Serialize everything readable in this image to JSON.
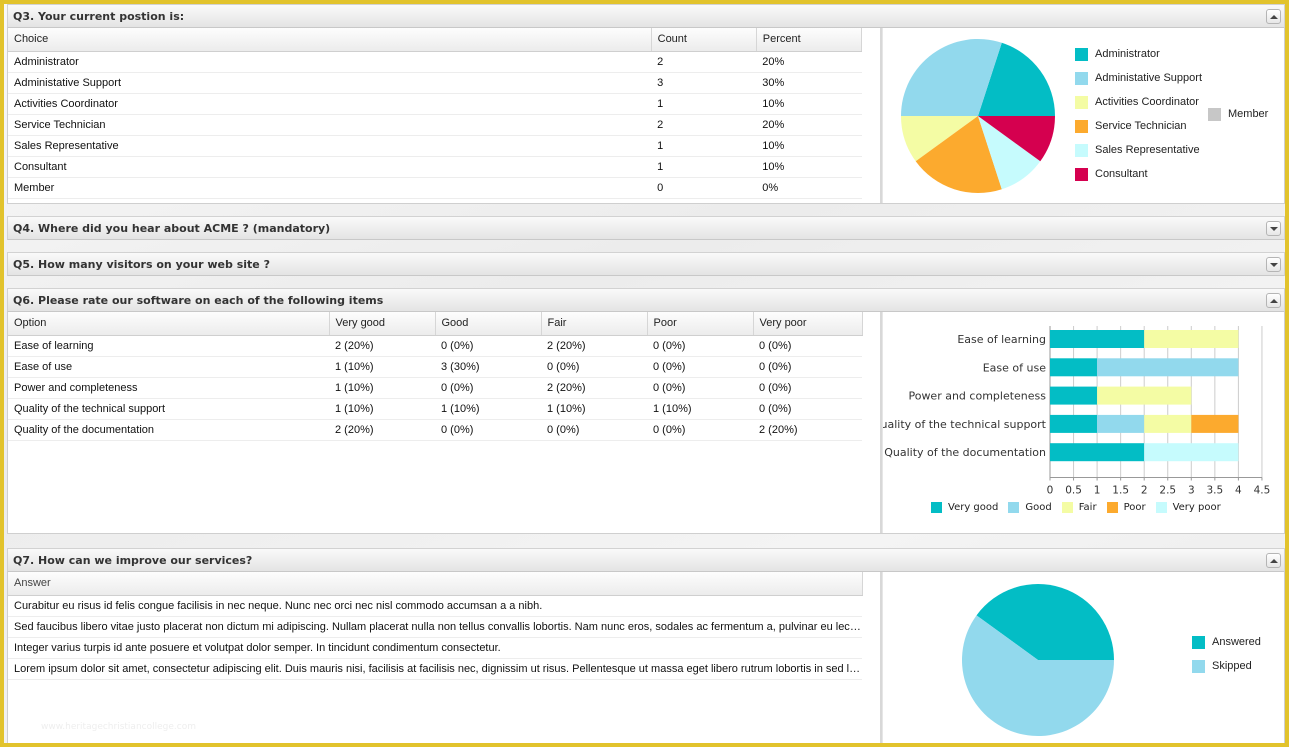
{
  "colors": {
    "teal": "#03bdc5",
    "sky": "#92d9ed",
    "yellow": "#f4fca4",
    "orange": "#fcaa2e",
    "pale_cyan": "#c6fbfd",
    "crimson": "#d5004f",
    "gray": "#c7c7c7"
  },
  "q3": {
    "title": "Q3. Your current postion is:",
    "toggle": "collapse",
    "columns": [
      "Choice",
      "Count",
      "Percent"
    ],
    "rows": [
      {
        "choice": "Administrator",
        "count": "2",
        "percent": "20%"
      },
      {
        "choice": "Administative Support",
        "count": "3",
        "percent": "30%"
      },
      {
        "choice": "Activities Coordinator",
        "count": "1",
        "percent": "10%"
      },
      {
        "choice": "Service Technician",
        "count": "2",
        "percent": "20%"
      },
      {
        "choice": "Sales Representative",
        "count": "1",
        "percent": "10%"
      },
      {
        "choice": "Consultant",
        "count": "1",
        "percent": "10%"
      },
      {
        "choice": "Member",
        "count": "0",
        "percent": "0%"
      }
    ]
  },
  "q4": {
    "title": "Q4. Where did you hear about ACME ? (mandatory)",
    "toggle": "expand"
  },
  "q5": {
    "title": "Q5. How many visitors on your web site ?",
    "toggle": "expand"
  },
  "q6": {
    "title": "Q6. Please rate our software on each of the following items",
    "toggle": "collapse",
    "columns": [
      "Option",
      "Very good",
      "Good",
      "Fair",
      "Poor",
      "Very poor"
    ],
    "rows": [
      {
        "option": "Ease of learning",
        "cells": [
          "2 (20%)",
          "0 (0%)",
          "2 (20%)",
          "0 (0%)",
          "0 (0%)"
        ]
      },
      {
        "option": "Ease of use",
        "cells": [
          "1 (10%)",
          "3 (30%)",
          "0 (0%)",
          "0 (0%)",
          "0 (0%)"
        ]
      },
      {
        "option": "Power and completeness",
        "cells": [
          "1 (10%)",
          "0 (0%)",
          "2 (20%)",
          "0 (0%)",
          "0 (0%)"
        ]
      },
      {
        "option": "Quality of the technical support",
        "cells": [
          "1 (10%)",
          "1 (10%)",
          "1 (10%)",
          "1 (10%)",
          "0 (0%)"
        ]
      },
      {
        "option": "Quality of the documentation",
        "cells": [
          "2 (20%)",
          "0 (0%)",
          "0 (0%)",
          "0 (0%)",
          "2 (20%)"
        ]
      }
    ]
  },
  "q7": {
    "title": "Q7. How can we improve our services?",
    "toggle": "collapse",
    "columns": [
      "Answer"
    ],
    "rows": [
      "Curabitur eu risus id felis congue facilisis in nec neque. Nunc nec orci nec nisl commodo accumsan a a nibh.",
      "Sed faucibus libero vitae justo placerat non dictum mi adipiscing. Nullam placerat nulla non tellus convallis lobortis. Nam nunc eros, sodales ac fermentum a, pulvinar eu lectus.",
      "Integer varius turpis id ante posuere et volutpat dolor semper. In tincidunt condimentum consectetur.",
      "Lorem ipsum dolor sit amet, consectetur adipiscing elit. Duis mauris nisi, facilisis at facilisis nec, dignissim ut risus. Pellentesque ut massa eget libero rutrum lobortis in sed lac..."
    ],
    "watermark": "www.heritagechristiancollege.com"
  },
  "chart_data": [
    {
      "type": "pie",
      "title": "Q3. Your current postion is:",
      "labels": [
        "Administrator",
        "Administative Support",
        "Activities Coordinator",
        "Service Technician",
        "Sales Representative",
        "Consultant",
        "Member"
      ],
      "values": [
        2,
        3,
        1,
        2,
        1,
        1,
        0
      ],
      "colors": [
        "#03bdc5",
        "#92d9ed",
        "#f4fca4",
        "#fcaa2e",
        "#c6fbfd",
        "#d5004f",
        "#c7c7c7"
      ],
      "legend": "right"
    },
    {
      "type": "bar",
      "orientation": "horizontal",
      "stacked": true,
      "title": "Q6. Please rate our software on each of the following items",
      "categories": [
        "Ease of learning",
        "Ease of use",
        "Power and completeness",
        "Quality of the technical support",
        "Quality of the documentation"
      ],
      "series": [
        {
          "name": "Very good",
          "values": [
            2,
            1,
            1,
            1,
            2
          ],
          "color": "#03bdc5"
        },
        {
          "name": "Good",
          "values": [
            0,
            3,
            0,
            1,
            0
          ],
          "color": "#92d9ed"
        },
        {
          "name": "Fair",
          "values": [
            2,
            0,
            2,
            1,
            0
          ],
          "color": "#f4fca4"
        },
        {
          "name": "Poor",
          "values": [
            0,
            0,
            0,
            1,
            0
          ],
          "color": "#fcaa2e"
        },
        {
          "name": "Very poor",
          "values": [
            0,
            0,
            0,
            0,
            2
          ],
          "color": "#c6fbfd"
        }
      ],
      "xlim": [
        0,
        4.5
      ],
      "xticks": [
        "0",
        "0.5",
        "1",
        "1.5",
        "2",
        "2.5",
        "3",
        "3.5",
        "4",
        "4.5"
      ],
      "grid": true,
      "legend": "bottom"
    },
    {
      "type": "pie",
      "title": "Q7. How can we improve our services?",
      "labels": [
        "Answered",
        "Skipped"
      ],
      "values": [
        4,
        6
      ],
      "colors": [
        "#03bdc5",
        "#92d9ed"
      ],
      "legend": "right"
    }
  ]
}
